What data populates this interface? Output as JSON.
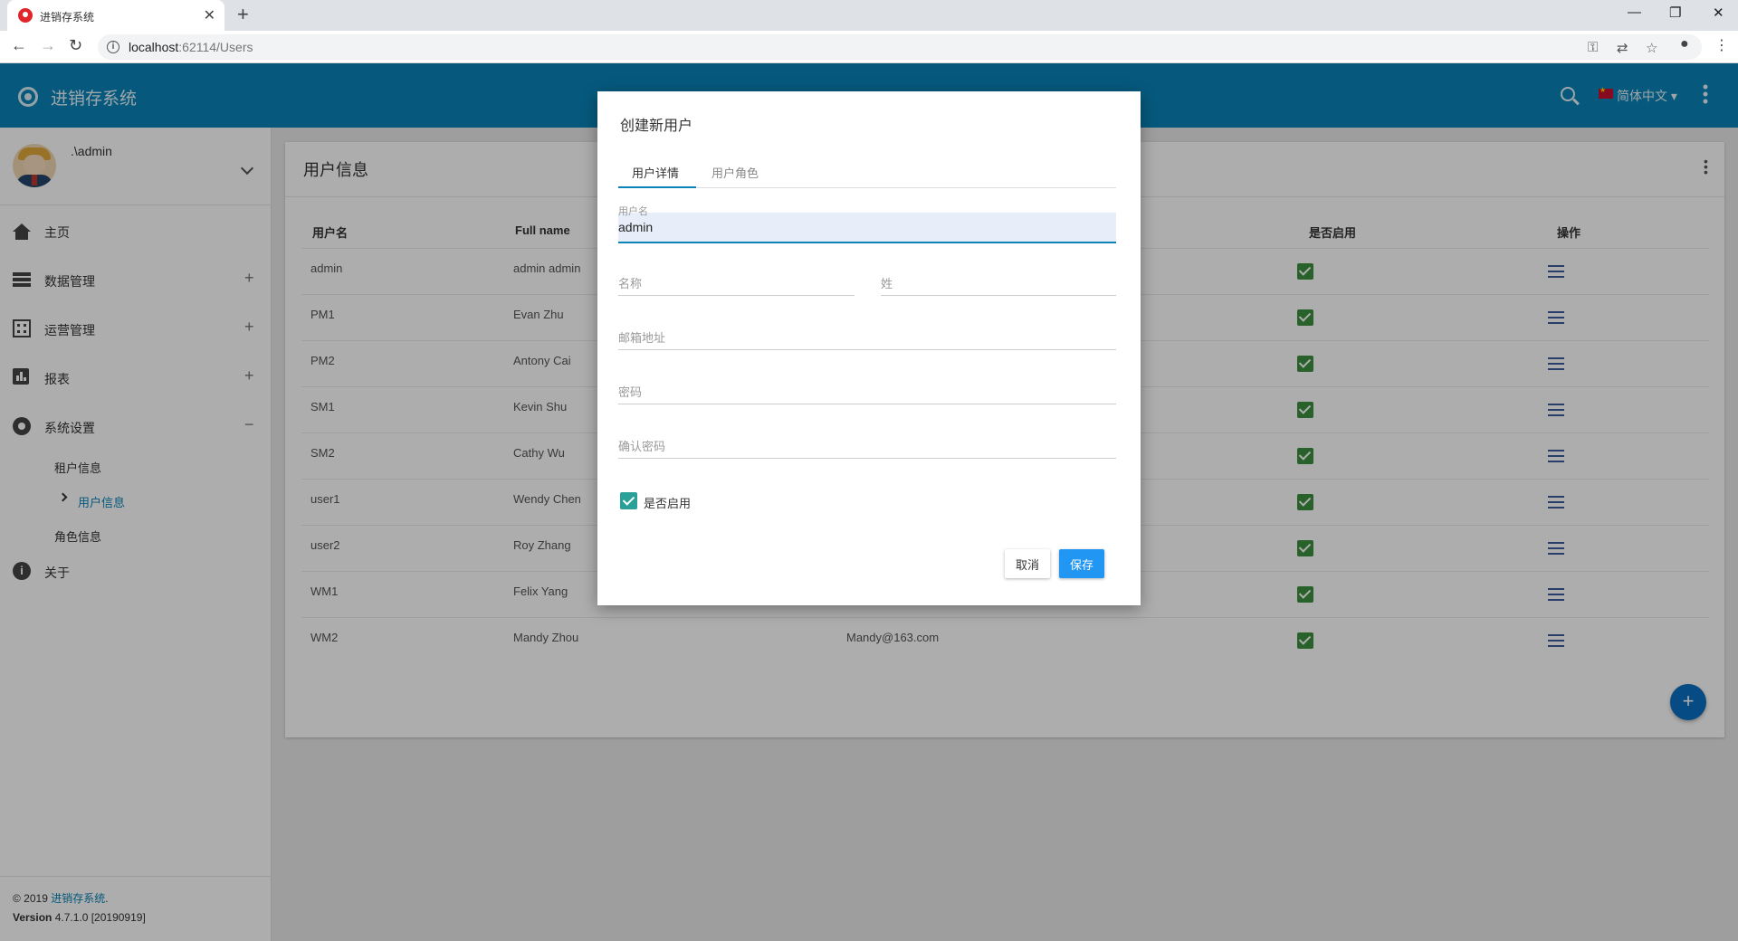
{
  "browser": {
    "tab_title": "进销存系统",
    "url_host": "localhost",
    "url_rest": ":62114/Users",
    "new_tab": "+",
    "close": "✕"
  },
  "app": {
    "name": "进销存系统",
    "language": "简体中文 ▾"
  },
  "sidebar": {
    "user_name": ".\\admin",
    "menu": [
      {
        "label": "主页",
        "icon": "home-icon",
        "sign": ""
      },
      {
        "label": "数据管理",
        "icon": "list-icon",
        "sign": "+"
      },
      {
        "label": "运营管理",
        "icon": "building-icon",
        "sign": "+"
      },
      {
        "label": "报表",
        "icon": "chart-icon",
        "sign": "+"
      },
      {
        "label": "系统设置",
        "icon": "gear-icon",
        "sign": "−"
      },
      {
        "label": "关于",
        "icon": "info-icon",
        "sign": ""
      }
    ],
    "submenu": [
      {
        "label": "租户信息",
        "active": false
      },
      {
        "label": "用户信息",
        "active": true
      },
      {
        "label": "角色信息",
        "active": false
      }
    ],
    "footer": {
      "copyright_prefix": "© 2019 ",
      "copyright_link": "进销存系统",
      "copyright_suffix": ".",
      "version_label": "Version",
      "version_value": " 4.7.1.0 [20190919]"
    }
  },
  "card": {
    "title": "用户信息",
    "headers": [
      "用户名",
      "Full name",
      "是否启用",
      "操作"
    ],
    "rows": [
      {
        "username": "admin",
        "full_name": "admin admin",
        "email": "",
        "active": true
      },
      {
        "username": "PM1",
        "full_name": "Evan Zhu",
        "email": "",
        "active": true
      },
      {
        "username": "PM2",
        "full_name": "Antony Cai",
        "email": "",
        "active": true
      },
      {
        "username": "SM1",
        "full_name": "Kevin Shu",
        "email": "",
        "active": true
      },
      {
        "username": "SM2",
        "full_name": "Cathy Wu",
        "email": "",
        "active": true
      },
      {
        "username": "user1",
        "full_name": "Wendy Chen",
        "email": "",
        "active": true
      },
      {
        "username": "user2",
        "full_name": "Roy Zhang",
        "email": "",
        "active": true
      },
      {
        "username": "WM1",
        "full_name": "Felix Yang",
        "email": "",
        "active": true
      },
      {
        "username": "WM2",
        "full_name": "Mandy Zhou",
        "email": "Mandy@163.com",
        "active": true
      }
    ],
    "fab": "+"
  },
  "modal": {
    "title": "创建新用户",
    "tabs": [
      "用户详情",
      "用户角色"
    ],
    "fields": {
      "username_label": "用户名",
      "username_value": "admin",
      "name_label": "名称",
      "surname_label": "姓",
      "email_label": "邮箱地址",
      "password_label": "密码",
      "confirm_label": "确认密码"
    },
    "active_label": "是否启用",
    "active_checked": true,
    "cancel": "取消",
    "save": "保存"
  },
  "colors": {
    "header": "#0a83b8",
    "accent": "#2196f3",
    "check_green": "#3b8f3d"
  }
}
